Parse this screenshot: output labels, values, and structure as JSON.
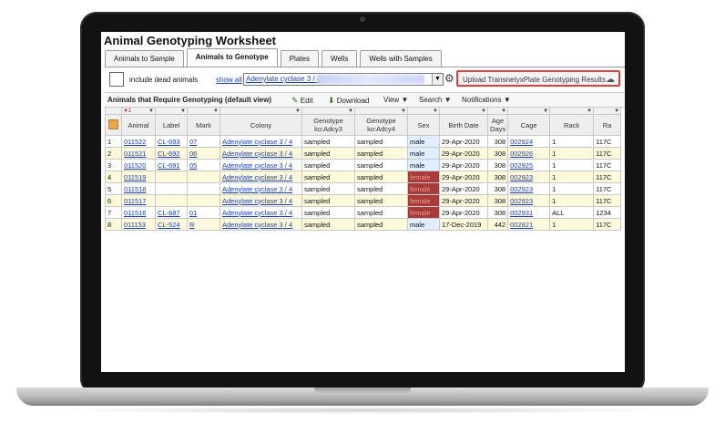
{
  "app": {
    "title": "Animal Genotyping Worksheet",
    "tabs": [
      {
        "label": "Animals to Sample",
        "active": false
      },
      {
        "label": "Animals to Genotype",
        "active": true
      },
      {
        "label": "Plates",
        "active": false
      },
      {
        "label": "Wells",
        "active": false
      },
      {
        "label": "Wells with Samples",
        "active": false
      }
    ]
  },
  "controls": {
    "include_dead_label": "include dead animals",
    "show_all_label": "show all",
    "colony_select_value": "Adenylate cyclase 3 / 4",
    "upload_button_label": "Upload TransnetyxPlate Genotyping Results"
  },
  "toolbar": {
    "grid_title": "Animals that Require Genotyping (default view)",
    "edit_label": "Edit",
    "download_label": "Download",
    "view_label": "View",
    "search_label": "Search",
    "notifications_label": "Notifications"
  },
  "icons": {
    "gear": "gear-icon",
    "cloud": "cloud-upload-icon",
    "edit": "edit-icon",
    "download": "download-icon"
  },
  "colors": {
    "upload_highlight": "#e0403a",
    "female_cell": "#a83a37",
    "male_cell": "#dfefff",
    "row_alt": "#fdf9dc",
    "link": "#1a3fbf"
  },
  "table": {
    "sort_indicator": "▼1",
    "columns": [
      "Animal",
      "Label",
      "Mark",
      "Colony",
      "Genotype ko:Adcy3",
      "Genotype ko:Adcy4",
      "Sex",
      "Birth Date",
      "Age Days",
      "Cage",
      "Rack",
      "Ra"
    ],
    "rows": [
      {
        "n": "1",
        "animal": "011522",
        "label": "CL-693",
        "mark": "07",
        "colony": "Adenylate cyclase 3 / 4",
        "g3": "sampled",
        "g4": "sampled",
        "sex": "male",
        "birth": "29-Apr-2020",
        "age": "308",
        "cage": "002924",
        "rack": "1",
        "ra": "117C"
      },
      {
        "n": "2",
        "animal": "011521",
        "label": "CL-692",
        "mark": "06",
        "colony": "Adenylate cyclase 3 / 4",
        "g3": "sampled",
        "g4": "sampled",
        "sex": "male",
        "birth": "29-Apr-2020",
        "age": "308",
        "cage": "002926",
        "rack": "1",
        "ra": "117C"
      },
      {
        "n": "3",
        "animal": "011520",
        "label": "CL-691",
        "mark": "05",
        "colony": "Adenylate cyclase 3 / 4",
        "g3": "sampled",
        "g4": "sampled",
        "sex": "male",
        "birth": "29-Apr-2020",
        "age": "308",
        "cage": "002925",
        "rack": "1",
        "ra": "117C"
      },
      {
        "n": "4",
        "animal": "011519",
        "label": "",
        "mark": "",
        "colony": "Adenylate cyclase 3 / 4",
        "g3": "sampled",
        "g4": "sampled",
        "sex": "female",
        "birth": "29-Apr-2020",
        "age": "308",
        "cage": "002923",
        "rack": "1",
        "ra": "117C"
      },
      {
        "n": "5",
        "animal": "011518",
        "label": "",
        "mark": "",
        "colony": "Adenylate cyclase 3 / 4",
        "g3": "sampled",
        "g4": "sampled",
        "sex": "female",
        "birth": "29-Apr-2020",
        "age": "308",
        "cage": "002923",
        "rack": "1",
        "ra": "117C"
      },
      {
        "n": "6",
        "animal": "011517",
        "label": "",
        "mark": "",
        "colony": "Adenylate cyclase 3 / 4",
        "g3": "sampled",
        "g4": "sampled",
        "sex": "female",
        "birth": "29-Apr-2020",
        "age": "308",
        "cage": "002923",
        "rack": "1",
        "ra": "117C"
      },
      {
        "n": "7",
        "animal": "011516",
        "label": "CL-687",
        "mark": "01",
        "colony": "Adenylate cyclase 3 / 4",
        "g3": "sampled",
        "g4": "sampled",
        "sex": "female",
        "birth": "29-Apr-2020",
        "age": "308",
        "cage": "002931",
        "rack": "ALL",
        "ra": "1234"
      },
      {
        "n": "8",
        "animal": "011153",
        "label": "CL-524",
        "mark": "R",
        "colony": "Adenylate cyclase 3 / 4",
        "g3": "sampled",
        "g4": "sampled",
        "sex": "male",
        "birth": "17-Dec-2019",
        "age": "442",
        "cage": "002821",
        "rack": "1",
        "ra": "117C"
      }
    ]
  }
}
